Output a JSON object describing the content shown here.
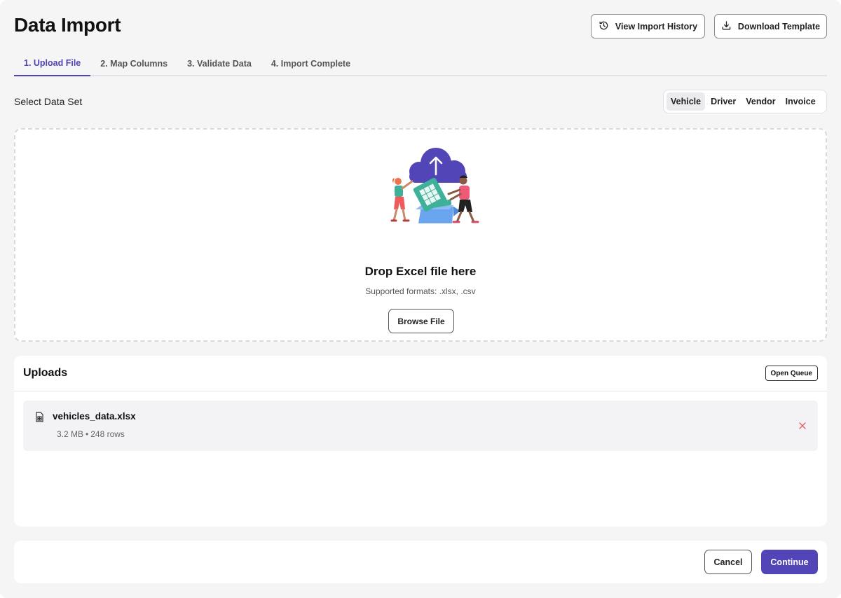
{
  "header": {
    "title": "Data Import",
    "history_button": {
      "label": "View Import History",
      "icon": "history-icon"
    },
    "template_button": {
      "label": "Download Template",
      "icon": "download-icon"
    }
  },
  "tabs": [
    {
      "label": "1. Upload File",
      "active": true
    },
    {
      "label": "2. Map Columns",
      "active": false
    },
    {
      "label": "3. Validate Data",
      "active": false
    },
    {
      "label": "4. Import Complete",
      "active": false
    }
  ],
  "dataset": {
    "label": "Select Data Set",
    "options": [
      "Vehicle",
      "Driver",
      "Vendor",
      "Invoice"
    ],
    "selected": "Vehicle"
  },
  "dropzone": {
    "illustration": "upload-illustration",
    "title": "Drop Excel file here",
    "subtitle": "Supported formats: .xlsx, .csv",
    "browse_label": "Browse File"
  },
  "uploads": {
    "title": "Uploads",
    "queue_label": "Open Queue",
    "files": [
      {
        "name": "vehicles_data.xlsx",
        "size": "3.2 MB",
        "separator": "•",
        "rows": "248 rows",
        "icon": "spreadsheet-file-icon"
      }
    ]
  },
  "footer": {
    "cancel_label": "Cancel",
    "continue_label": "Continue"
  },
  "colors": {
    "accent": "#5145b8",
    "tab_active": "#4f46b5",
    "remove": "#e05a5a",
    "cloud": "#5145b8",
    "box": "#6aa6ef"
  }
}
